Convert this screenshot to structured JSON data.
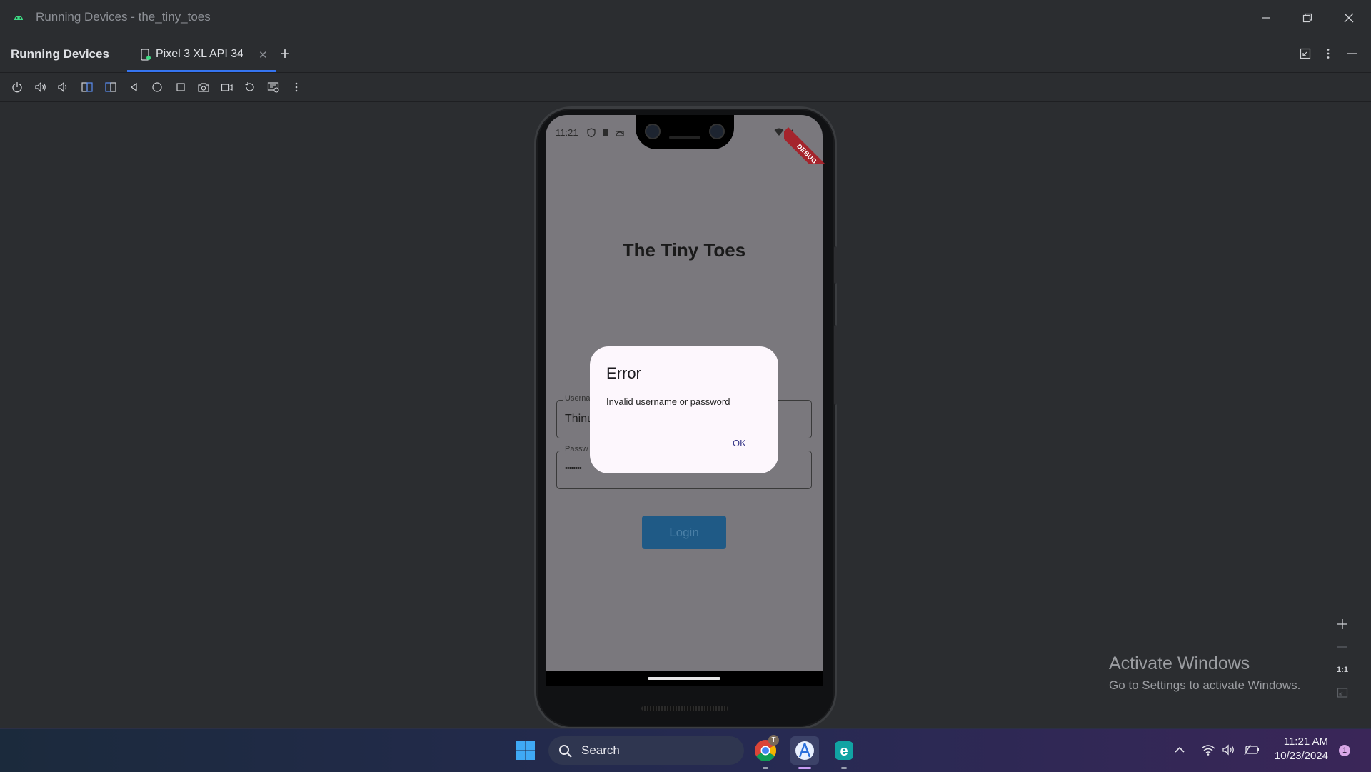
{
  "window": {
    "title": "Running Devices - the_tiny_toes"
  },
  "tool_window": {
    "title": "Running Devices",
    "tabs": [
      {
        "label": "Pixel 3 XL API 34",
        "selected": true
      }
    ]
  },
  "toolbar": {
    "icons": [
      "power-icon",
      "volume-up-icon",
      "volume-down-icon",
      "rotate-left-icon",
      "rotate-right-icon",
      "back-icon",
      "home-icon",
      "overview-icon",
      "screenshot-icon",
      "screen-record-icon",
      "reset-icon",
      "snapshot-icon",
      "more-icon"
    ]
  },
  "device": {
    "status_time": "11:21",
    "debug_banner": "DEBUG",
    "app_title": "The Tiny Toes",
    "username_label": "Userna",
    "username_value": "Thinu",
    "password_label": "Passw",
    "password_value": "••••••••",
    "login_label": "Login",
    "dialog": {
      "title": "Error",
      "message": "Invalid username or password",
      "ok_label": "OK"
    }
  },
  "zoom_controls": {
    "one_to_one": "1:1"
  },
  "watermark": {
    "line1": "Activate Windows",
    "line2": "Go to Settings to activate Windows."
  },
  "taskbar": {
    "search_label": "Search",
    "chrome_badge": "T",
    "time": "11:21 AM",
    "date": "10/23/2024",
    "notification_count": "1"
  },
  "colors": {
    "accent": "#3574f0",
    "ide_background": "#2b2d30",
    "dialog_background": "#fdf7fd",
    "debug_banner": "#a5242c"
  }
}
